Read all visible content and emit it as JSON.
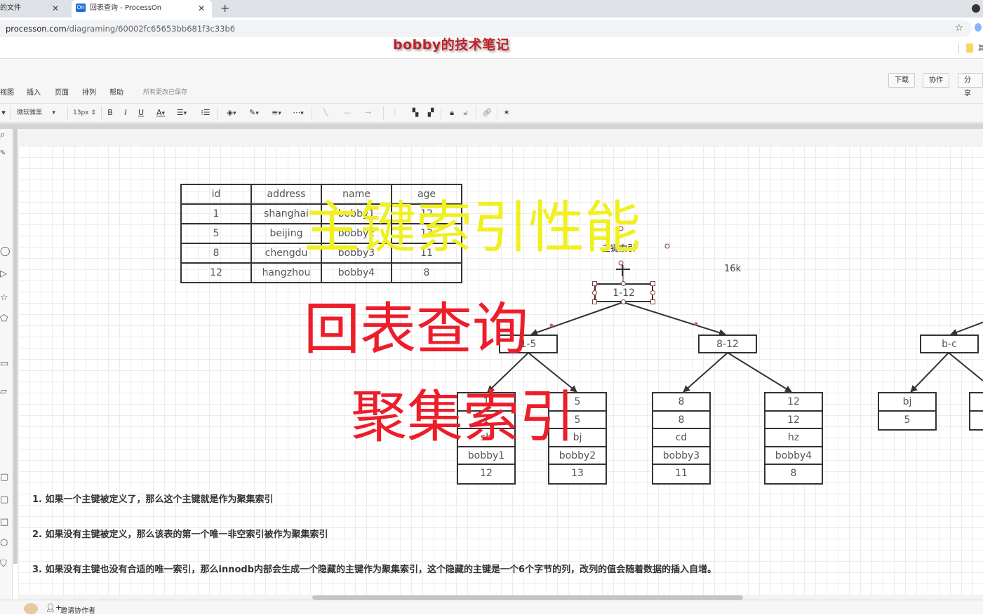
{
  "browser": {
    "tabs": [
      {
        "title": "的文件",
        "active": false
      },
      {
        "title": "回表查询 - ProcessOn",
        "active": true,
        "favicon": "On"
      }
    ],
    "new_tab": "+",
    "close": "✕",
    "url_host": "processon.com",
    "url_path": "/diagraming/60002fc65653bb681f3c33b6",
    "bookmark_partial": "其"
  },
  "watermark": "bobby的技术笔记",
  "app": {
    "menu": [
      "视图",
      "插入",
      "页面",
      "排列",
      "帮助"
    ],
    "save_status": "所有更改已保存",
    "header_buttons": [
      "下载",
      "协作",
      "分享"
    ],
    "toolbar": {
      "font_family": "微软雅黑",
      "font_size": "13px",
      "bold": "B",
      "italic": "I",
      "underline": "U",
      "font_color": "A"
    },
    "status_bar": {
      "invite": "邀请协作者"
    }
  },
  "diagram": {
    "table": {
      "headers": [
        "id",
        "address",
        "name",
        "age"
      ],
      "rows": [
        [
          "1",
          "shanghai",
          "bobby1",
          "12"
        ],
        [
          "5",
          "beijing",
          "bobby2",
          "13"
        ],
        [
          "8",
          "chengdu",
          "bobby3",
          "11"
        ],
        [
          "12",
          "hangzhou",
          "bobby4",
          "8"
        ]
      ]
    },
    "primary_index_label": "主键索引",
    "page_size_label": "16k",
    "root": "1-12",
    "internal_nodes": [
      "1-5",
      "8-12"
    ],
    "leaves": [
      [
        "1",
        "1",
        "sh",
        "bobby1",
        "12"
      ],
      [
        "5",
        "5",
        "bj",
        "bobby2",
        "13"
      ],
      [
        "8",
        "8",
        "cd",
        "bobby3",
        "11"
      ],
      [
        "12",
        "12",
        "hz",
        "bobby4",
        "8"
      ]
    ],
    "secondary_node": "b-c",
    "secondary_leaves": [
      [
        "bj",
        "5"
      ]
    ],
    "notes": [
      "1.  如果一个主键被定义了，那么这个主键就是作为聚集索引",
      "2.  如果没有主键被定义，那么该表的第一个唯一非空索引被作为聚集索引",
      "3.  如果没有主键也没有合适的唯一索引，那么innodb内部会生成一个隐藏的主键作为聚集索引，这个隐藏的主键是一个6个字节的列，改列的值会随着数据的插入自增。"
    ]
  },
  "overlays": {
    "yellow": "主键索引性能",
    "red1": "回表查询",
    "red2": "聚集索引",
    "colors": {
      "yellow": "#f0f021",
      "red": "#ee1d2a"
    }
  }
}
